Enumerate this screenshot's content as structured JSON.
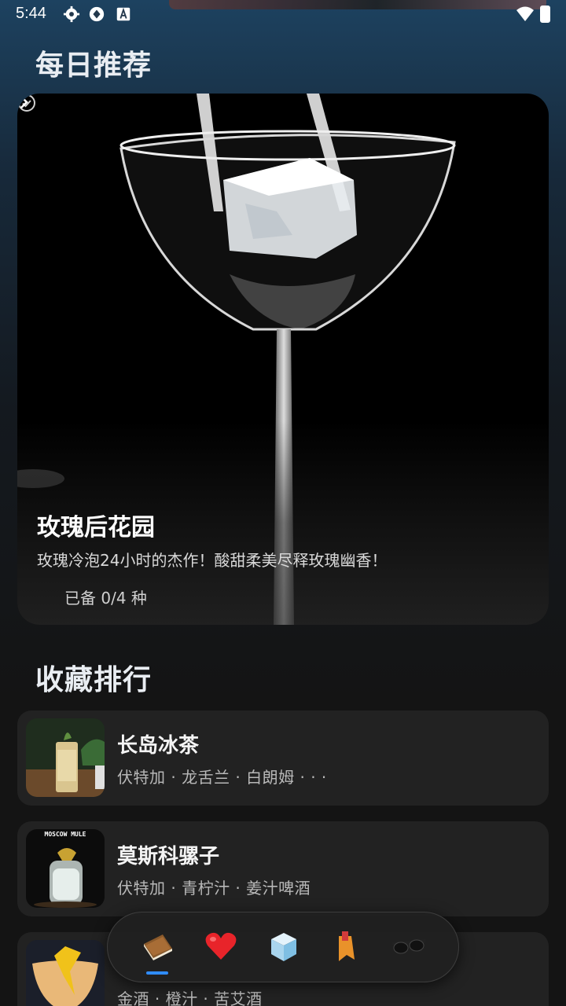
{
  "status_bar": {
    "time": "5:44"
  },
  "daily": {
    "section_title": "每日推荐",
    "title": "玫瑰后花园",
    "description": "玫瑰冷泡24小时的杰作！酸甜柔美尽释玫瑰幽香！",
    "stock": "已备 0/4 种"
  },
  "favorites": {
    "section_title": "收藏排行",
    "items": [
      {
        "name": "长岛冰茶",
        "ingredients": "伏特加 · 龙舌兰 · 白朗姆 · · ·"
      },
      {
        "name": "莫斯科骡子",
        "ingredients": "伏特加 · 青柠汁 · 姜汁啤酒",
        "thumb_text": "MOSCOW MULE"
      },
      {
        "name": "",
        "ingredients": "金酒 · 橙汁 · 苦艾酒"
      }
    ]
  },
  "nav": {
    "items": [
      {
        "icon": "notebook-icon",
        "active": true
      },
      {
        "icon": "heart-icon",
        "active": false
      },
      {
        "icon": "ice-cube-icon",
        "active": false
      },
      {
        "icon": "tag-icon",
        "active": false
      },
      {
        "icon": "sunglasses-icon",
        "active": false
      }
    ],
    "accent": "#2f8cff"
  }
}
